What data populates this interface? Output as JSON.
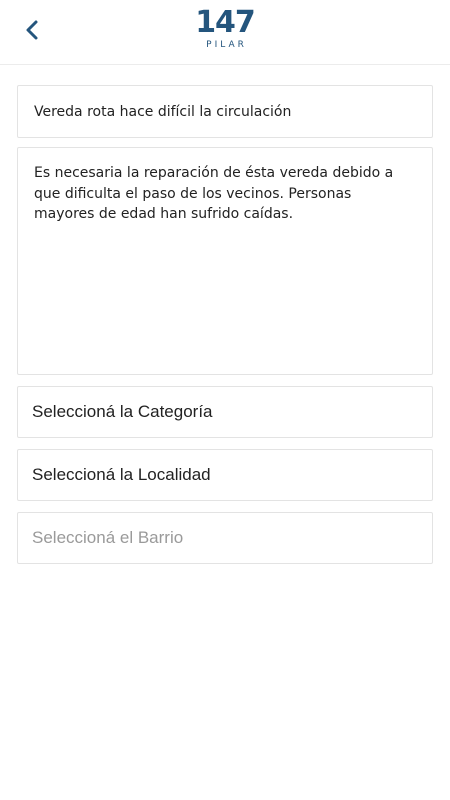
{
  "header": {
    "back_icon": "chevron-left-icon",
    "logo_number": "147",
    "logo_sub": "PILAR",
    "brand_color": "#24557d"
  },
  "form": {
    "title_value": "Vereda rota hace difícil la circulación",
    "description_value": "Es necesaria la reparación de ésta vereda debido a que dificulta el paso de los vecinos. Personas mayores de edad han sufrido caídas.",
    "categoria_label": "Seleccioná la Categoría",
    "localidad_label": "Seleccioná la Localidad",
    "barrio_label": "Seleccioná el Barrio"
  }
}
